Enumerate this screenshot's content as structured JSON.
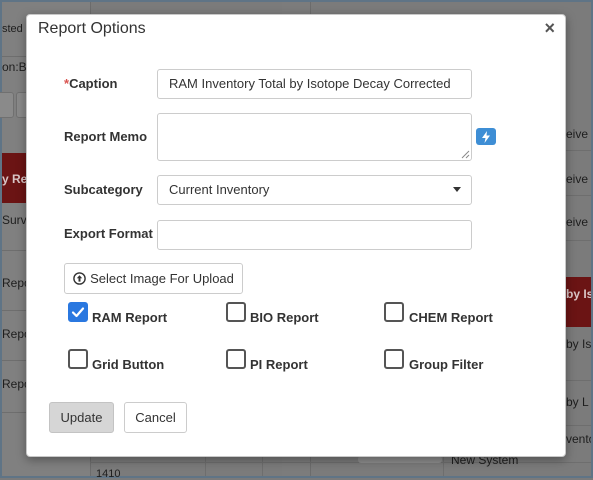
{
  "background": {
    "fragments": [
      {
        "name": "bg-text-sted",
        "text": "sted"
      },
      {
        "name": "bg-text-on-b",
        "text": "on:B"
      },
      {
        "name": "bg-text-y-repo",
        "text": "y Repo"
      },
      {
        "name": "bg-text-survey",
        "text": "Survey"
      },
      {
        "name": "bg-text-repo-1",
        "text": "Repo"
      },
      {
        "name": "bg-text-repo-2",
        "text": "Repo"
      },
      {
        "name": "bg-text-repo-3",
        "text": "Repo"
      },
      {
        "name": "bg-text-eive-1",
        "text": "eive"
      },
      {
        "name": "bg-text-eive-2",
        "text": "eive"
      },
      {
        "name": "bg-text-eive-3",
        "text": "eive"
      },
      {
        "name": "bg-text-by-is-red",
        "text": "by Is"
      },
      {
        "name": "bg-text-by-is",
        "text": "by Is"
      },
      {
        "name": "bg-text-by-l",
        "text": "by L"
      },
      {
        "name": "bg-text-invento",
        "text": "vento"
      },
      {
        "name": "bg-text-new-system",
        "text": "New System"
      },
      {
        "name": "bg-text-1410",
        "text": "1410"
      }
    ]
  },
  "modal": {
    "title": "Report Options",
    "close_glyph": "×",
    "caption": {
      "label": "Caption",
      "required_mark": "*",
      "value": "RAM Inventory Total by Isotope Decay Corrected"
    },
    "report_memo": {
      "label": "Report Memo",
      "value": "",
      "action_icon": "lightning-bolt-icon"
    },
    "subcategory": {
      "label": "Subcategory",
      "selected": "Current Inventory"
    },
    "export_format": {
      "label": "Export Format",
      "value": ""
    },
    "upload_button": {
      "label": "Select Image For Upload",
      "icon": "upload-circle-icon"
    },
    "checkboxes": [
      {
        "id": "ram",
        "label": "RAM Report",
        "checked": true
      },
      {
        "id": "bio",
        "label": "BIO Report",
        "checked": false
      },
      {
        "id": "chem",
        "label": "CHEM Report",
        "checked": false
      },
      {
        "id": "grid",
        "label": "Grid Button",
        "checked": false
      },
      {
        "id": "pi",
        "label": "PI Report",
        "checked": false
      },
      {
        "id": "group",
        "label": "Group Filter",
        "checked": false
      }
    ],
    "update_label": "Update",
    "cancel_label": "Cancel"
  },
  "colors": {
    "required": "#d9534f",
    "checkbox_checked": "#2a78e0",
    "memo_action": "#3e8ed5",
    "background_accent": "#6b1414"
  }
}
